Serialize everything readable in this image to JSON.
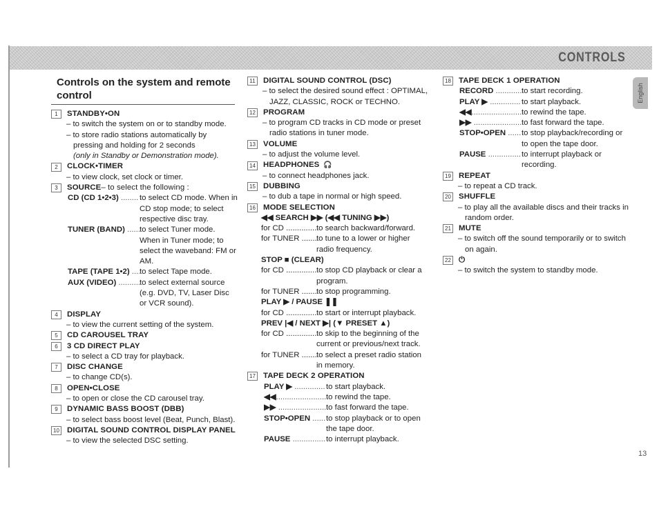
{
  "header": {
    "title": "CONTROLS",
    "language_tab": "English"
  },
  "section_title": "Controls on the system and remote control",
  "page_number": "13",
  "items": [
    {
      "num": "1",
      "title": "STANDBY•ON",
      "lines": [
        "to switch the system on or to standby mode.",
        "to store radio stations automatically by pressing and holding for 2 seconds"
      ],
      "italic_note": "(only in Standby or Demonstration mode)."
    },
    {
      "num": "2",
      "title": "CLOCK•TIMER",
      "lines": [
        "to view clock, set clock or timer."
      ]
    },
    {
      "num": "3",
      "title": "SOURCE",
      "title_suffix": " – to select the following :",
      "sub": [
        {
          "key": "CD (CD 1•2•3)",
          "dots": " ........",
          "value": "to select CD mode.  When in CD stop mode; to select respective disc tray."
        },
        {
          "key": "TUNER (BAND)",
          "dots": " .......",
          "value": "to select Tuner mode.  When in Tuner mode; to select the waveband:  FM or AM."
        },
        {
          "key": "TAPE (TAPE 1•2)",
          "dots": " .....",
          "value": "to select Tape mode."
        },
        {
          "key": "AUX (VIDEO)",
          "dots": " ............",
          "value": "to select external source (e.g. DVD, TV, Laser Disc or VCR sound)."
        }
      ]
    },
    {
      "num": "4",
      "title": "DISPLAY",
      "lines": [
        "to view the current setting of the system."
      ]
    },
    {
      "num": "5",
      "title": "CD CAROUSEL TRAY",
      "lines": []
    },
    {
      "num": "6",
      "title": "3 CD DIRECT PLAY",
      "lines": [
        "to select a CD tray for playback."
      ]
    },
    {
      "num": "7",
      "title": "DISC CHANGE",
      "lines": [
        "to change CD(s)."
      ]
    },
    {
      "num": "8",
      "title": "OPEN•CLOSE",
      "lines": [
        "to open or close the CD carousel tray."
      ]
    },
    {
      "num": "9",
      "title": "DYNAMIC BASS BOOST  (DBB)",
      "lines": [
        "to select bass boost level (Beat, Punch, Blast)."
      ]
    },
    {
      "num": "10",
      "title": "DIGITAL SOUND CONTROL DISPLAY PANEL",
      "lines": [
        "to view the selected DSC setting."
      ]
    },
    {
      "num": "11",
      "title": "DIGITAL SOUND CONTROL  (DSC)",
      "lines": [
        "to select the desired sound effect : OPTIMAL, JAZZ, CLASSIC, ROCK or TECHNO."
      ]
    },
    {
      "num": "12",
      "title": "PROGRAM",
      "lines": [
        "to program CD tracks in CD mode or preset radio stations in tuner mode."
      ]
    },
    {
      "num": "13",
      "title": "VOLUME",
      "lines": [
        "to adjust the volume level."
      ]
    },
    {
      "num": "14",
      "title": "HEADPHONES",
      "title_icon": "🎧",
      "lines": [
        "to connect headphones jack."
      ]
    },
    {
      "num": "15",
      "title": "DUBBING",
      "lines": [
        "to dub a tape in normal or high speed."
      ]
    },
    {
      "num": "16",
      "title": "MODE SELECTION",
      "modes": [
        {
          "label": "◀◀ SEARCH ▶▶  (◀◀ TUNING ▶▶)",
          "rows": [
            {
              "key": "for CD ...............",
              "value": "to search backward/forward."
            },
            {
              "key": "for TUNER ..........",
              "value": "to tune to a lower or higher radio frequency."
            }
          ]
        },
        {
          "label": "STOP ■   (CLEAR)",
          "rows": [
            {
              "key": "for CD ...............",
              "value": "to stop CD playback or clear a program."
            },
            {
              "key": "for TUNER ..........",
              "value": "to stop programming."
            }
          ]
        },
        {
          "label": "PLAY ▶  / PAUSE ❚❚",
          "rows": [
            {
              "key": "for CD ...............",
              "value": "to start or interrupt playback."
            }
          ]
        },
        {
          "label": "PREV |◀ / NEXT ▶|  (▼ PRESET ▲)",
          "rows": [
            {
              "key": "for CD ...............",
              "value": "to skip to the beginning of the current or previous/next track."
            },
            {
              "key": "for TUNER ..........",
              "value": "to select a preset radio station in memory."
            }
          ]
        }
      ]
    },
    {
      "num": "17",
      "title": "TAPE DECK 2 OPERATION",
      "sub": [
        {
          "key": "PLAY ▶",
          "dots": " ..............",
          "value": "to start playback."
        },
        {
          "key": "◀◀",
          "dots": "........................",
          "value": "to rewind the tape."
        },
        {
          "key": "▶▶",
          "dots": " ......................",
          "value": "to fast forward the tape."
        },
        {
          "key": "STOP•OPEN",
          "dots": " .......",
          "value": "to stop playback or to open the tape door."
        },
        {
          "key": "PAUSE",
          "dots": " ................",
          "value": "to interrupt playback."
        }
      ]
    },
    {
      "num": "18",
      "title": "TAPE DECK 1 OPERATION",
      "sub": [
        {
          "key": "RECORD",
          "dots": " .............",
          "value": "to start recording."
        },
        {
          "key": "PLAY ▶",
          "dots": " ..............",
          "value": "to start playback."
        },
        {
          "key": "◀◀",
          "dots": "........................",
          "value": "to rewind the tape."
        },
        {
          "key": "▶▶",
          "dots": " ......................",
          "value": "to fast forward the tape."
        },
        {
          "key": "STOP•OPEN",
          "dots": " .......",
          "value": "to stop playback/recording or to open the tape door."
        },
        {
          "key": "PAUSE",
          "dots": " ................",
          "value": "to interrupt playback or recording."
        }
      ]
    },
    {
      "num": "19",
      "title": "REPEAT",
      "lines": [
        "to repeat a CD track."
      ]
    },
    {
      "num": "20",
      "title": "SHUFFLE",
      "lines": [
        "to play all the available discs and their tracks in random order."
      ]
    },
    {
      "num": "21",
      "title": "MUTE",
      "lines": [
        "to switch off the sound temporarily or to switch on again."
      ]
    },
    {
      "num": "22",
      "title": "⏻",
      "lines": [
        "to switch the system to standby mode."
      ]
    }
  ]
}
